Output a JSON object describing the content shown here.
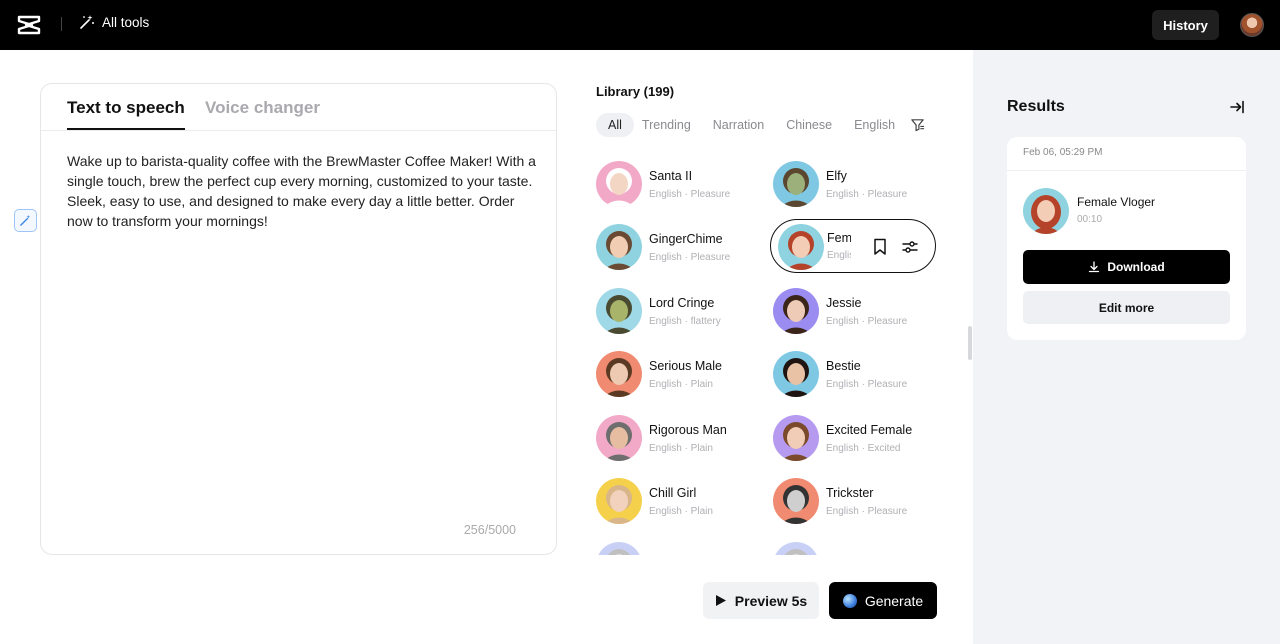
{
  "topbar": {
    "logo_icon": "capcut-logo-icon",
    "all_tools_label": "All tools",
    "history_label": "History"
  },
  "editor": {
    "tabs": [
      {
        "label": "Text to speech",
        "active": true
      },
      {
        "label": "Voice changer",
        "active": false
      }
    ],
    "text": "Wake up to barista-quality coffee with the BrewMaster Coffee Maker! With a single touch, brew the perfect cup every morning, customized to your taste. Sleek, easy to use, and designed to make every day a little better. Order now to transform your mornings!",
    "counter": "256/5000"
  },
  "library": {
    "title": "Library (199)",
    "filters": [
      "All",
      "Trending",
      "Narration",
      "Chinese",
      "English"
    ],
    "voices": [
      {
        "name": "Santa II",
        "sub": "English · Pleasure",
        "bg": "#f2a8c7",
        "skin": "#f3d6c4",
        "hair": "#ffffff"
      },
      {
        "name": "Elfy",
        "sub": "English · Pleasure",
        "bg": "#7ec8e3",
        "skin": "#9bb07a",
        "hair": "#5b4630"
      },
      {
        "name": "GingerChime",
        "sub": "English · Pleasure",
        "bg": "#8fd3e0",
        "skin": "#f1cdb3",
        "hair": "#6a4a32"
      },
      {
        "name": "Female Vloger",
        "sub": "English · Pleasure",
        "bg": "#8fd3e0",
        "skin": "#f4cdb6",
        "hair": "#b5432a",
        "selected": true
      },
      {
        "name": "Lord Cringe",
        "sub": "English · flattery",
        "bg": "#9fd8e6",
        "skin": "#a7b46a",
        "hair": "#4a4a30"
      },
      {
        "name": "Jessie",
        "sub": "English · Pleasure",
        "bg": "#9a8cf0",
        "skin": "#eecbb6",
        "hair": "#3b2418"
      },
      {
        "name": "Serious Male",
        "sub": "English · Plain",
        "bg": "#f08a70",
        "skin": "#efcab2",
        "hair": "#5a3a22"
      },
      {
        "name": "Bestie",
        "sub": "English · Pleasure",
        "bg": "#7ec8e3",
        "skin": "#e9c2a6",
        "hair": "#1f1410"
      },
      {
        "name": "Rigorous Man",
        "sub": "English · Plain",
        "bg": "#f2a8c7",
        "skin": "#e6bda0",
        "hair": "#6e6e6e"
      },
      {
        "name": "Excited Female",
        "sub": "English · Excited",
        "bg": "#b59af0",
        "skin": "#f1cdb8",
        "hair": "#7a4a2a"
      },
      {
        "name": "Chill Girl",
        "sub": "English · Plain",
        "bg": "#f5d04a",
        "skin": "#f2d2bd",
        "hair": "#d9b68a"
      },
      {
        "name": "Trickster",
        "sub": "English · Pleasure",
        "bg": "#f08a70",
        "skin": "#cfcfcf",
        "hair": "#333333"
      },
      {
        "name": "",
        "sub": "",
        "bg": "#c9d0f5",
        "skin": "#e0e0e0",
        "hair": "#c0c0c0"
      },
      {
        "name": "",
        "sub": "",
        "bg": "#c9d0f5",
        "skin": "#e0e0e0",
        "hair": "#c0c0c0"
      }
    ]
  },
  "actions": {
    "preview_label": "Preview 5s",
    "generate_label": "Generate"
  },
  "results": {
    "title": "Results",
    "date": "Feb 06, 05:29 PM",
    "voice_name": "Female Vloger",
    "duration": "00:10",
    "download_label": "Download",
    "edit_label": "Edit more"
  }
}
